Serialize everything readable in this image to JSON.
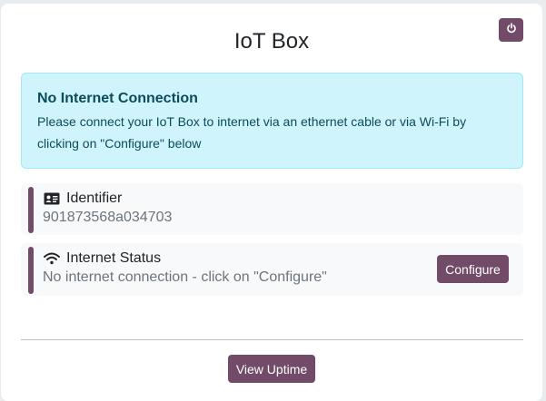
{
  "page": {
    "title": "IoT Box"
  },
  "alert": {
    "heading": "No Internet Connection",
    "message": "Please connect your IoT Box to internet via an ethernet cable or via Wi-Fi by clicking on \"Configure\" below"
  },
  "identifier": {
    "icon": "id-card-icon",
    "label": "Identifier",
    "value": "901873568a034703"
  },
  "internet_status": {
    "icon": "wifi-icon",
    "label": "Internet Status",
    "value": "No internet connection - click on \"Configure\"",
    "button_label": "Configure"
  },
  "footer": {
    "uptime_button_label": "View Uptime"
  },
  "colors": {
    "brand": "#714b67",
    "alert_bg": "#cff4fc",
    "alert_text": "#0b4c5a",
    "muted_text": "#6c757d"
  },
  "icons": {
    "power": "power-icon"
  }
}
